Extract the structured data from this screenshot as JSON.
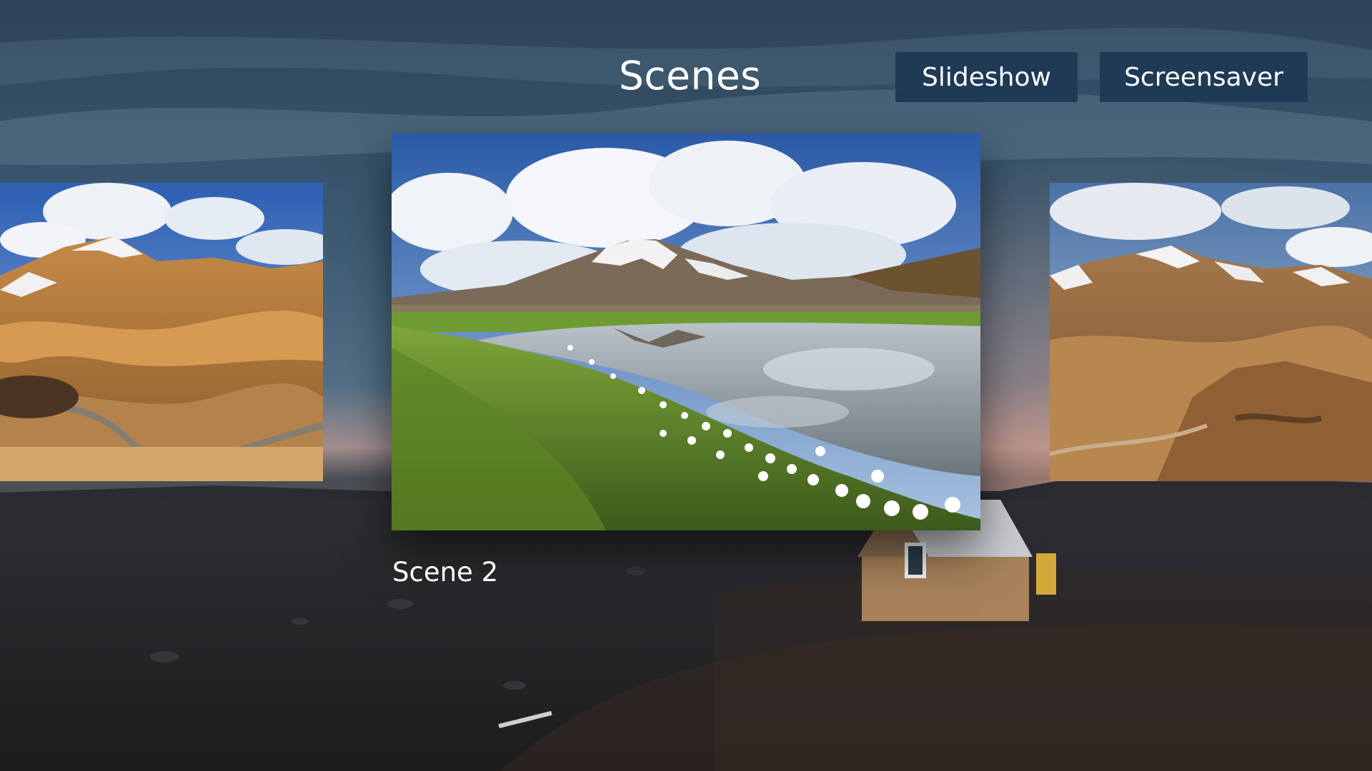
{
  "header": {
    "title": "Scenes",
    "buttons": [
      {
        "id": "slideshow",
        "label": "Slideshow"
      },
      {
        "id": "screensaver",
        "label": "Screensaver"
      }
    ]
  },
  "carousel": {
    "focused_label": "Scene 2",
    "items": [
      {
        "id": "scene-1",
        "position": "left",
        "description": "volcanic rhyolite mountains"
      },
      {
        "id": "scene-2",
        "position": "center",
        "description": "mountain reflected in pond with cotton grass"
      },
      {
        "id": "scene-3",
        "position": "right",
        "description": "snow-streaked mountain ridge"
      }
    ]
  },
  "colors": {
    "button_bg": "#1e3a55",
    "text": "#ffffff"
  }
}
